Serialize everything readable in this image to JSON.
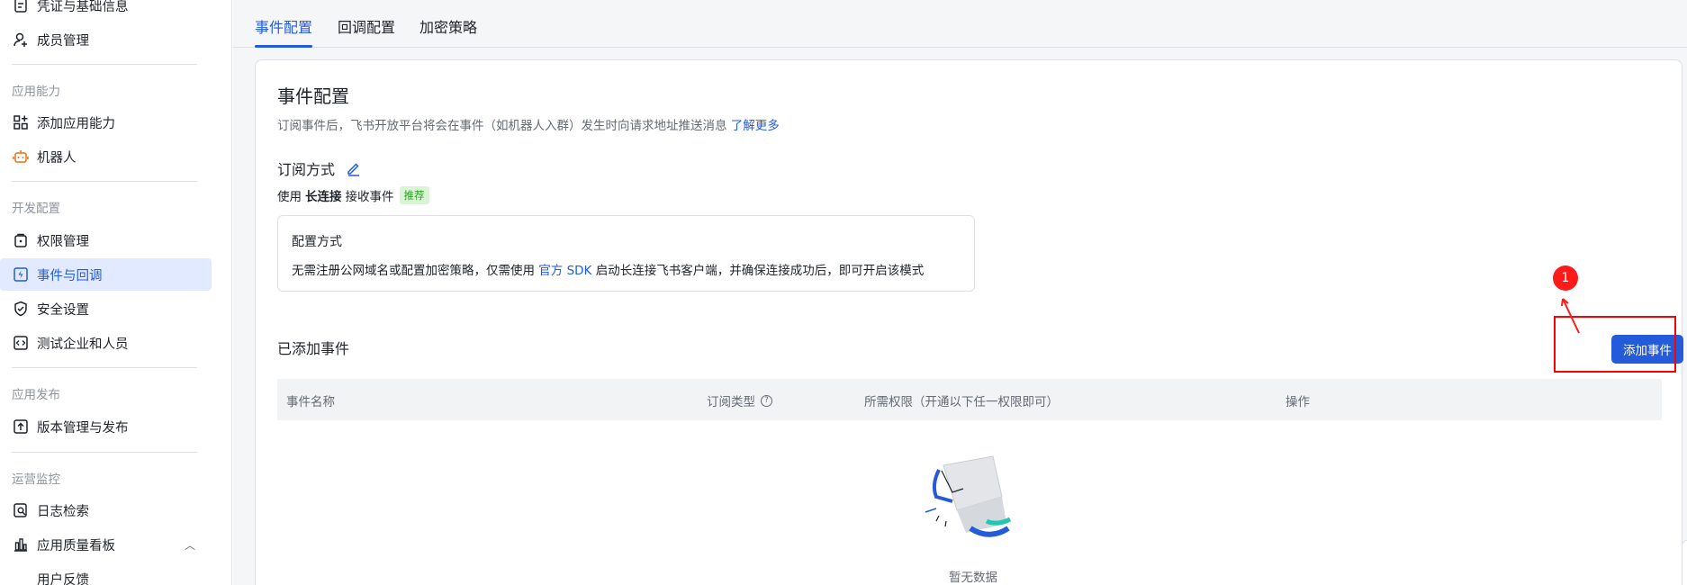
{
  "sidebar": {
    "top_item_partial": "凭证与基础信息",
    "member_item": "成员管理",
    "groups": {
      "app_capability": "应用能力",
      "dev_config": "开发配置",
      "app_publish": "应用发布",
      "ops_monitor": "运营监控"
    },
    "items": {
      "add_capability": "添加应用能力",
      "robot": "机器人",
      "permission": "权限管理",
      "events": "事件与回调",
      "security": "安全设置",
      "test_org": "测试企业和人员",
      "version": "版本管理与发布",
      "log_search": "日志检索",
      "quality_board": "应用质量看板",
      "feedback": "用户反馈"
    }
  },
  "tabs": {
    "event_config": "事件配置",
    "callback_config": "回调配置",
    "encrypt_strategy": "加密策略"
  },
  "card": {
    "title": "事件配置",
    "desc": "订阅事件后，飞书开放平台将会在事件（如机器人入群）发生时向请求地址推送消息",
    "learn_more": "了解更多",
    "subscribe_title": "订阅方式",
    "use_prefix": "使用",
    "use_bold": "长连接",
    "use_suffix": "接收事件",
    "recommend_badge": "推荐",
    "config_title": "配置方式",
    "config_text_1": "无需注册公网域名或配置加密策略，仅需使用",
    "config_link": "官方 SDK",
    "config_text_2": "启动长连接飞书客户端，并确保连接成功后，即可开启该模式",
    "added_title": "已添加事件",
    "add_button": "添加事件"
  },
  "table": {
    "headers": {
      "name": "事件名称",
      "type": "订阅类型",
      "permission": "所需权限（开通以下任一权限即可）",
      "action": "操作"
    },
    "empty_text": "暂无数据"
  },
  "annotation": {
    "step_number": "1",
    "color": "#ff0000"
  },
  "colors": {
    "primary": "#245bdb",
    "active_bg": "#e1eaff",
    "badge_bg": "#d9f5d6",
    "badge_text": "#2ea121"
  }
}
